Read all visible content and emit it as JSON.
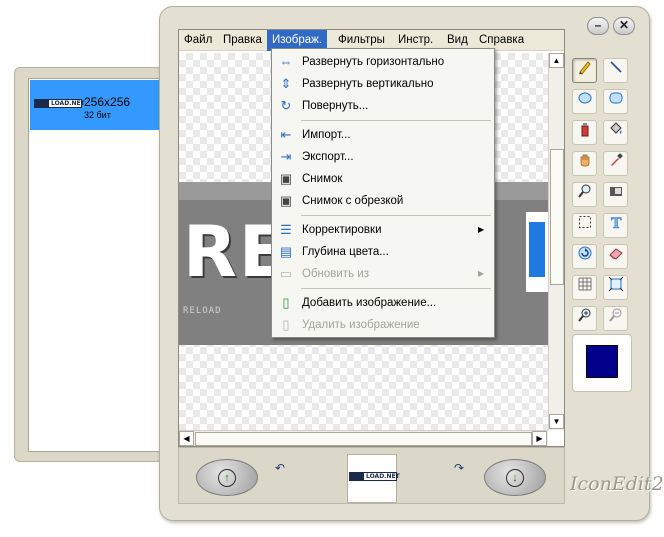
{
  "side_panel": {
    "items": [
      {
        "thumb_logo": "LOAD.NET",
        "title": "256x256",
        "subtitle": "32 бит"
      }
    ]
  },
  "window": {
    "minimize_glyph": "–",
    "close_glyph": "✕"
  },
  "menubar": {
    "items": [
      "Файл",
      "Правка",
      "Изображ.",
      "Фильтры",
      "Инстр.",
      "Вид",
      "Справка"
    ],
    "active_index": 2
  },
  "image_menu": {
    "items": [
      {
        "label": "Развернуть горизонтально",
        "icon": "flip-horizontal-icon"
      },
      {
        "label": "Развернуть вертикально",
        "icon": "flip-vertical-icon"
      },
      {
        "label": "Повернуть...",
        "icon": "rotate-icon"
      },
      {
        "label": "Импорт...",
        "icon": "import-icon"
      },
      {
        "label": "Экспорт...",
        "icon": "export-icon"
      },
      {
        "label": "Снимок",
        "icon": "snapshot-icon"
      },
      {
        "label": "Снимок с обрезкой",
        "icon": "snapshot-crop-icon"
      },
      {
        "label": "Корректировки",
        "icon": "adjustments-icon",
        "submenu": true
      },
      {
        "label": "Глубина цвета...",
        "icon": "color-depth-icon"
      },
      {
        "label": "Обновить из",
        "icon": "update-from-icon",
        "submenu": true,
        "disabled": true
      },
      {
        "label": "Добавить изображение...",
        "icon": "add-image-icon"
      },
      {
        "label": "Удалить изображение",
        "icon": "delete-image-icon",
        "disabled": true
      }
    ]
  },
  "toolbox": {
    "tools": [
      {
        "name": "pencil-icon",
        "selected": true
      },
      {
        "name": "line-icon"
      },
      {
        "name": "ellipse-select-icon"
      },
      {
        "name": "rounded-rect-icon"
      },
      {
        "name": "spray-icon"
      },
      {
        "name": "fill-bucket-icon"
      },
      {
        "name": "hand-icon"
      },
      {
        "name": "eyedropper-icon"
      },
      {
        "name": "magnifier-icon"
      },
      {
        "name": "camera-icon"
      },
      {
        "name": "rect-select-icon"
      },
      {
        "name": "text-tool-icon"
      },
      {
        "name": "rotate-tool-icon"
      },
      {
        "name": "eraser-icon"
      },
      {
        "name": "grid-icon"
      },
      {
        "name": "fit-icon"
      },
      {
        "name": "zoom-in-icon"
      },
      {
        "name": "zoom-out-icon"
      }
    ],
    "current_color": "#00008b"
  },
  "canvas": {
    "image_big_text": "RE",
    "image_small_text": "RELOAD"
  },
  "bottom_bar": {
    "thumb_logo": "LOAD.NET",
    "brand": "IconEdit2"
  },
  "colors": {
    "selection_blue": "#3399ff",
    "menu_active": "#316ac5",
    "window_bg": "#e3e0d2"
  }
}
